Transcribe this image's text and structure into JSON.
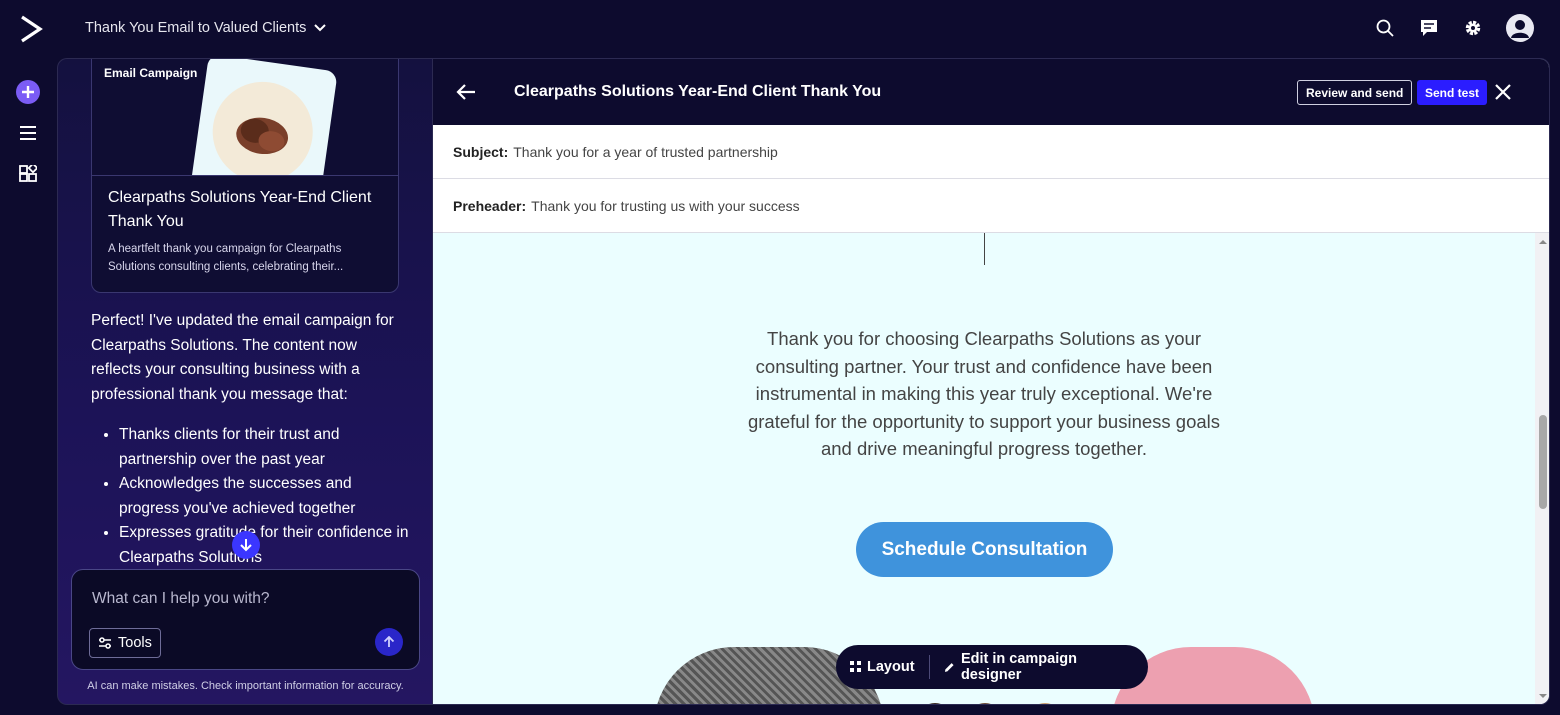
{
  "topbar": {
    "doc_title": "Thank You Email to Valued Clients",
    "icons": [
      "search-icon",
      "chat-icon",
      "gear-icon",
      "avatar"
    ]
  },
  "rail": {
    "items": [
      "plus-icon",
      "menu-icon",
      "apps-icon"
    ]
  },
  "chat": {
    "card": {
      "label": "Email Campaign",
      "title": "Clearpaths Solutions Year-End Client Thank You",
      "description": "A heartfelt thank you campaign for Clearpaths Solutions consulting clients, celebrating their..."
    },
    "message": {
      "intro": "Perfect! I've updated the email campaign for Clearpaths Solutions. The content now reflects your consulting business with a professional thank you message that:",
      "bullets": [
        "Thanks clients for their trust and partnership over the past year",
        "Acknowledges the successes and progress you've achieved together",
        "Expresses gratitude for their confidence in Clearpaths Solutions"
      ]
    },
    "composer": {
      "placeholder": "What can I help you with?",
      "tools_label": "Tools"
    },
    "disclaimer": "AI can make mistakes. Check important information for accuracy."
  },
  "editor": {
    "title": "Clearpaths Solutions Year-End Client Thank You",
    "review_label": "Review and send",
    "send_test_label": "Send test",
    "subject_label": "Subject:",
    "subject_value": "Thank you for a year of trusted partnership",
    "preheader_label": "Preheader:",
    "preheader_value": "Thank you for trusting us with your success",
    "body_text": "Thank you for choosing Clearpaths Solutions as your consulting partner. Your trust and confidence have been instrumental in making this year truly exceptional. We're grateful for the opportunity to support your business goals and drive meaningful progress together.",
    "cta_label": "Schedule Consultation",
    "floatbar": {
      "layout_label": "Layout",
      "edit_label": "Edit in campaign designer"
    }
  },
  "colors": {
    "app_bg": "#0d0b2e",
    "accent": "#2b1dff",
    "email_bg": "#ebfeff",
    "cta": "#3f93dc"
  }
}
